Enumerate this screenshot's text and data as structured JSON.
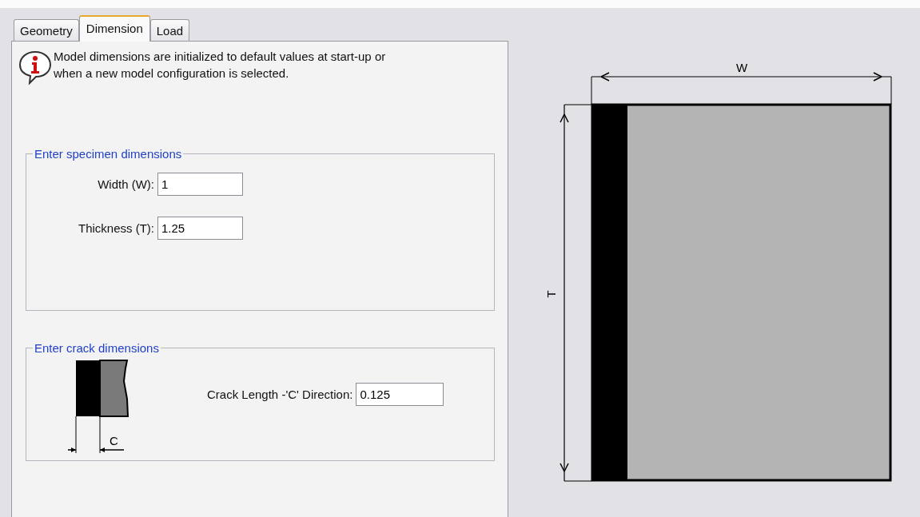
{
  "tabs": [
    {
      "label": "Geometry",
      "selected": false
    },
    {
      "label": "Dimension",
      "selected": true
    },
    {
      "label": "Load",
      "selected": false
    }
  ],
  "info_message": "Model dimensions are initialized to default values at start-up or when a new model configuration is selected.",
  "specimen_group": {
    "title": "Enter specimen dimensions",
    "fields": [
      {
        "label": "Width (W):",
        "value": "1"
      },
      {
        "label": "Thickness (T):",
        "value": "1.25"
      }
    ]
  },
  "crack_group": {
    "title": "Enter crack dimensions",
    "diagram_label": "C",
    "fields": [
      {
        "label": "Crack Length -'C' Direction:",
        "value": "0.125"
      }
    ]
  },
  "specimen_diagram": {
    "width_label": "W",
    "thickness_label": "T"
  }
}
